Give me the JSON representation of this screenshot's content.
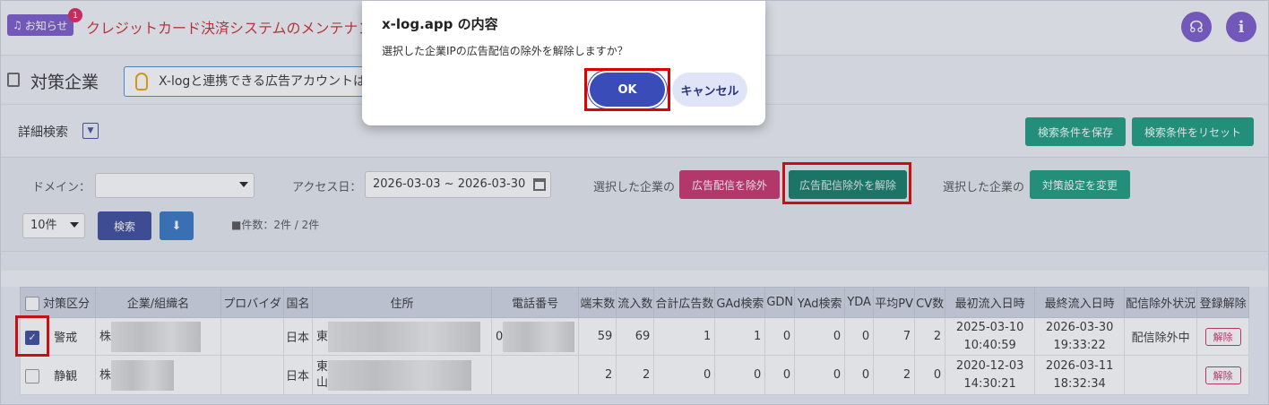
{
  "topbar": {
    "notice_label": "お知らせ",
    "notice_count": "1",
    "notice_text": "クレジットカード決済システムのメンテナンスの",
    "icons": [
      "headset-icon",
      "info-icon"
    ]
  },
  "header": {
    "title": "対策企業",
    "info_text": "X-logと連携できる広告アカウントは"
  },
  "search": {
    "detail_label": "詳細検索",
    "toggle_glyph": "▼",
    "save_button": "検索条件を保存",
    "reset_button": "検索条件をリセット"
  },
  "filters": {
    "domain_label": "ドメイン：",
    "domain_value": "",
    "access_label": "アクセス日：",
    "date_range": "2026-03-03 ~ 2026-03-30",
    "selected_label_1": "選択した企業の",
    "exclude_button": "広告配信を除外",
    "unexclude_button": "広告配信除外を解除",
    "selected_label_2": "選択した企業の",
    "change_button": "対策設定を変更",
    "per_page": "10件",
    "search_button": "検索",
    "download_glyph": "⬇",
    "count_text": "■件数：2件 / 2件"
  },
  "table": {
    "headers": [
      "対策区分",
      "企業/組織名",
      "プロバイダ",
      "国名",
      "住所",
      "電話番号",
      "端末数",
      "流入数",
      "合計広告数",
      "GAd検索",
      "GDN",
      "YAd検索",
      "YDA",
      "平均PV",
      "CV数",
      "最初流入日時",
      "最終流入日時",
      "配信除外状況",
      "登録解除"
    ],
    "rows": [
      {
        "checked": true,
        "check_glyph": "✓",
        "category": "警戒",
        "company": "株",
        "provider": "",
        "country": "日本",
        "address": "東",
        "phone": "0",
        "devices": "59",
        "visits": "69",
        "total_ads": "1",
        "gad": "1",
        "gdn": "0",
        "yad": "0",
        "yda": "0",
        "avg_pv": "7",
        "cv": "2",
        "first_date": "2025-03-10",
        "first_time": "10:40:59",
        "last_date": "2026-03-30",
        "last_time": "19:33:22",
        "status": "配信除外中",
        "unregister": "解除"
      },
      {
        "checked": false,
        "check_glyph": "",
        "category": "静観",
        "company": "株",
        "provider": "",
        "country": "日本",
        "address": "東",
        "address2": "山",
        "phone": "",
        "devices": "2",
        "visits": "2",
        "total_ads": "0",
        "gad": "0",
        "gdn": "0",
        "yad": "0",
        "yda": "0",
        "avg_pv": "2",
        "cv": "0",
        "first_date": "2020-12-03",
        "first_time": "14:30:21",
        "last_date": "2026-03-11",
        "last_time": "18:32:34",
        "status": "",
        "unregister": "解除"
      }
    ]
  },
  "dialog": {
    "title": "x-log.app の内容",
    "message": "選択した企業IPの広告配信の除外を解除しますか？",
    "ok_label": "OK",
    "cancel_label": "キャンセル"
  }
}
